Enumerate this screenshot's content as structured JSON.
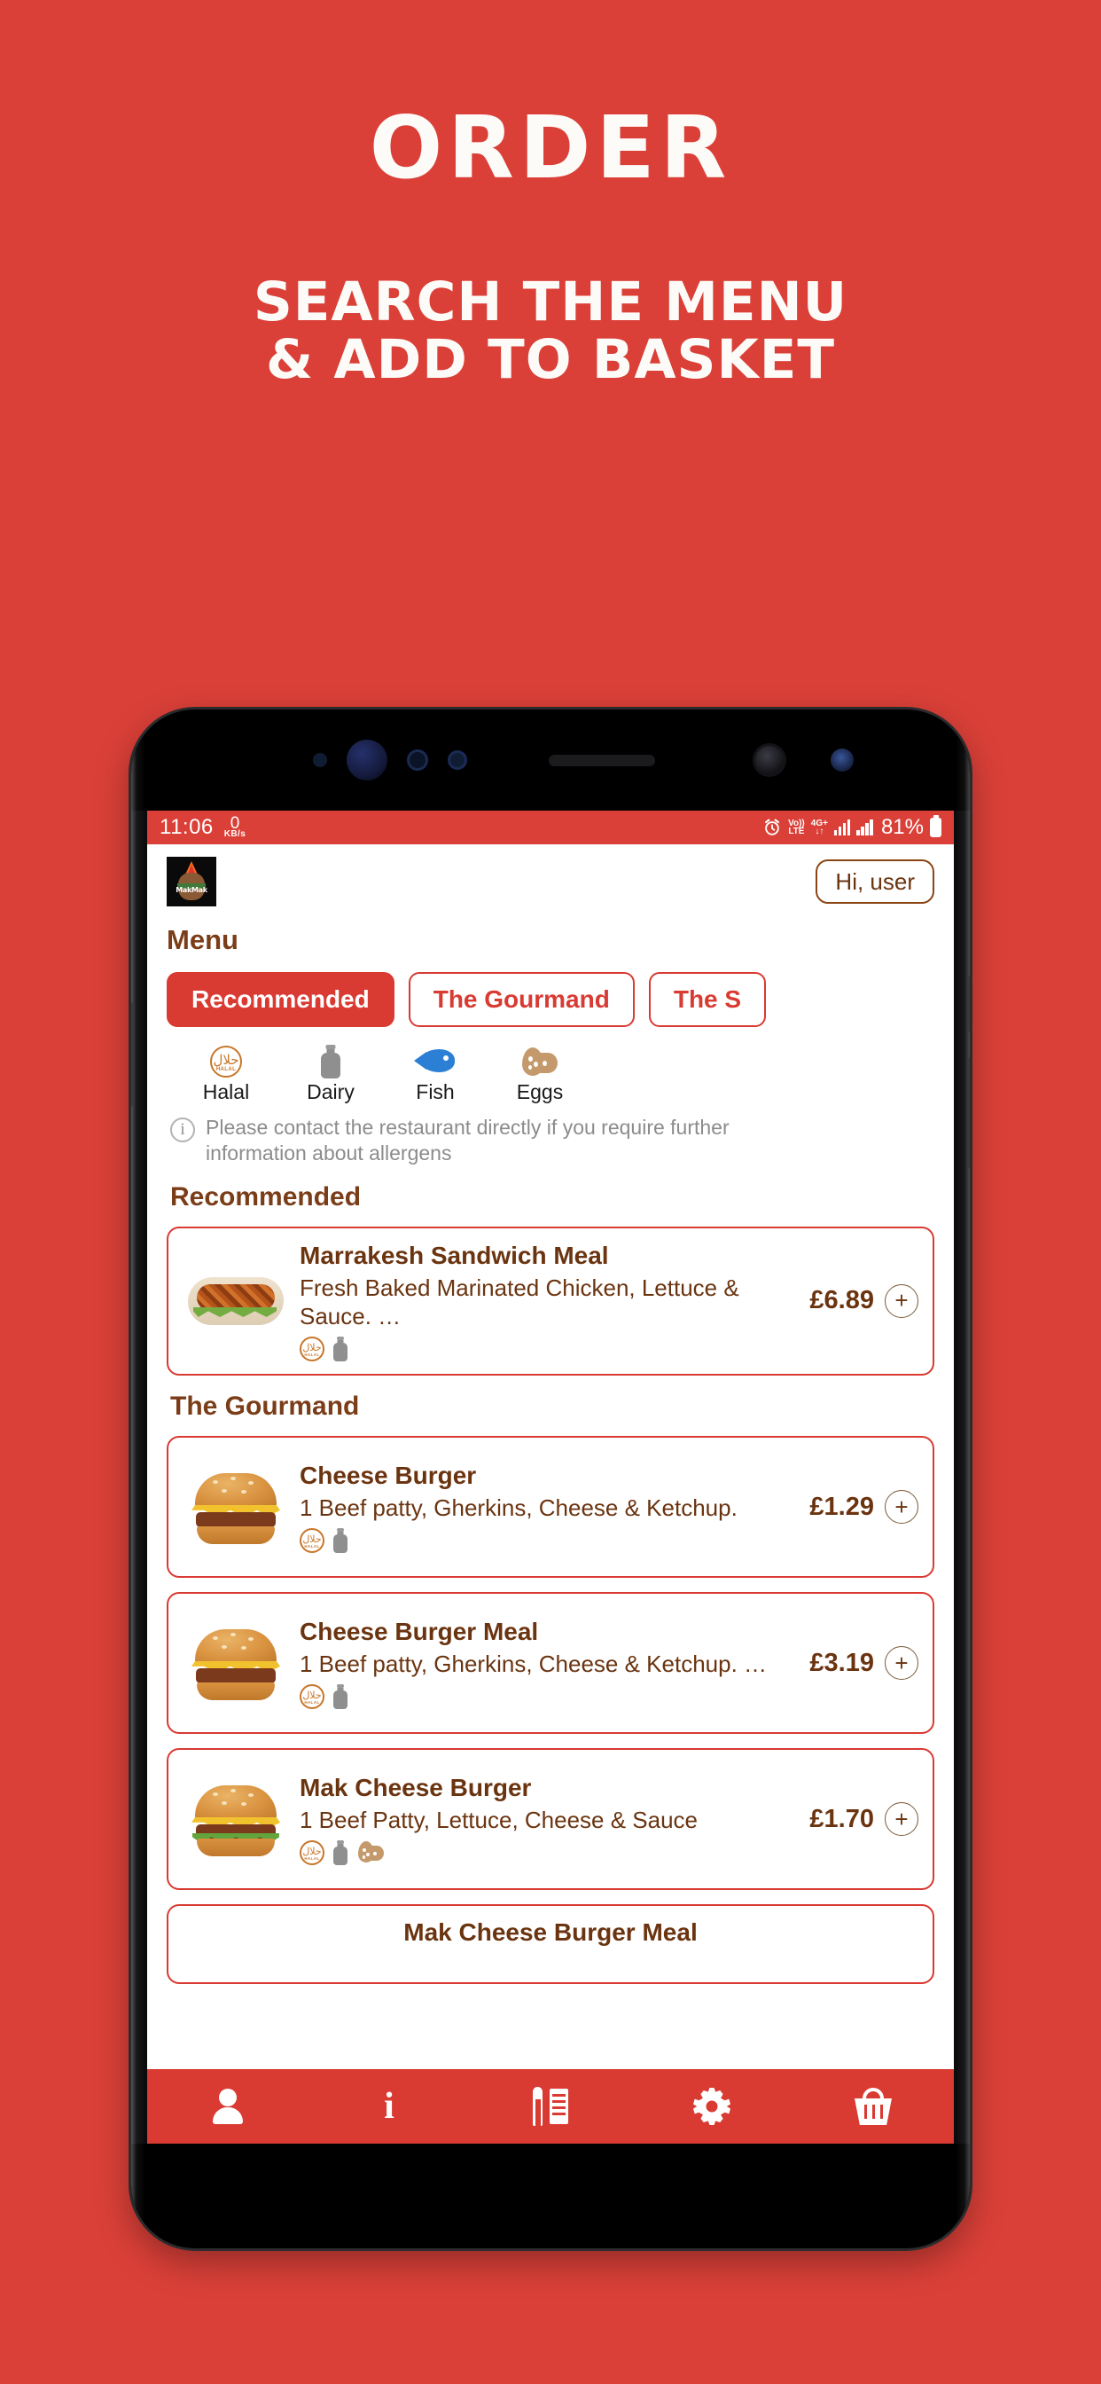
{
  "promo": {
    "title": "ORDER",
    "subtitle_line1": "SEARCH THE MENU",
    "subtitle_line2": "& ADD TO BASKET"
  },
  "colors": {
    "brand_red": "#da4038",
    "card_red": "#d93a32",
    "text_brown": "#6b3410",
    "heading_brown": "#7a3d18",
    "muted_grey": "#8c8c8c"
  },
  "statusbar": {
    "time": "11:06",
    "network_speed_value": "0",
    "network_speed_unit": "KB/s",
    "volte_line1": "Vo))",
    "volte_line2": "LTE",
    "network_line1": "4G+",
    "network_line2": "↓↑",
    "battery_percent": "81%",
    "alarm_icon": "alarm-clock-icon"
  },
  "app_header": {
    "logo_label": "MakMak",
    "greeting_button": "Hi, user"
  },
  "menu": {
    "title": "Menu",
    "tabs": [
      {
        "label": "Recommended",
        "active": true
      },
      {
        "label": "The Gourmand",
        "active": false
      },
      {
        "label": "The S",
        "active": false
      }
    ]
  },
  "allergen_legend": [
    {
      "label": "Halal",
      "icon": "halal-icon"
    },
    {
      "label": "Dairy",
      "icon": "milk-bottle-icon"
    },
    {
      "label": "Fish",
      "icon": "fish-icon"
    },
    {
      "label": "Eggs",
      "icon": "eggs-icon"
    }
  ],
  "allergen_note": "Please contact the restaurant directly if you require further information about allergens",
  "sections": [
    {
      "heading": "Recommended",
      "items": [
        {
          "name": "Marrakesh Sandwich Meal",
          "description": "Fresh Baked Marinated Chicken, Lettuce & Sauce. …",
          "price": "£6.89",
          "add_label": "+",
          "image": "sandwich",
          "allergens": [
            "halal",
            "dairy"
          ]
        }
      ]
    },
    {
      "heading": "The Gourmand",
      "items": [
        {
          "name": "Cheese Burger",
          "description": "1 Beef patty, Gherkins, Cheese & Ketchup.",
          "price": "£1.29",
          "add_label": "+",
          "image": "burger",
          "allergens": [
            "halal",
            "dairy"
          ]
        },
        {
          "name": "Cheese Burger Meal",
          "description": "1 Beef patty, Gherkins, Cheese & Ketchup.  …",
          "price": "£3.19",
          "add_label": "+",
          "image": "burger",
          "allergens": [
            "halal",
            "dairy"
          ]
        },
        {
          "name": "Mak Cheese Burger",
          "description": "1 Beef Patty, Lettuce, Cheese & Sauce",
          "price": "£1.70",
          "add_label": "+",
          "image": "burger",
          "allergens": [
            "halal",
            "dairy",
            "eggs"
          ]
        },
        {
          "name": "Mak Cheese Burger Meal",
          "description": "",
          "price": "",
          "add_label": "+",
          "image": "burger",
          "allergens": [],
          "partial": true
        }
      ]
    }
  ],
  "bottom_nav": [
    {
      "name": "account",
      "icon": "person-icon"
    },
    {
      "name": "info",
      "icon": "info-icon"
    },
    {
      "name": "menu",
      "icon": "menu-card-icon"
    },
    {
      "name": "settings",
      "icon": "gear-icon"
    },
    {
      "name": "basket",
      "icon": "basket-icon"
    }
  ]
}
